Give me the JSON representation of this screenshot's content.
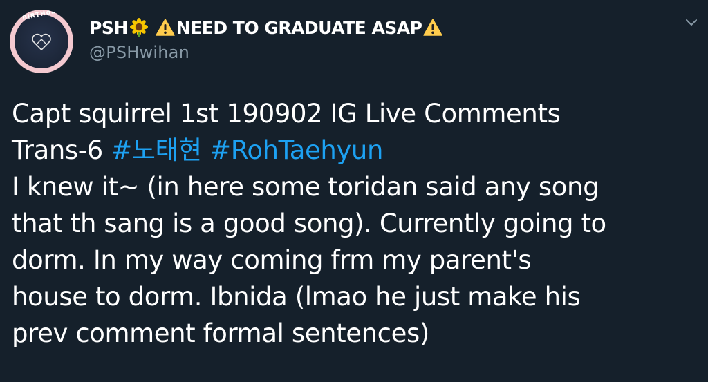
{
  "author": {
    "display_name_parts": [
      "PSH",
      "NEED TO GRADUATE ASAP"
    ],
    "display_name_emojis": [
      "sunflower-emoji",
      "warning-emoji",
      "warning-emoji"
    ],
    "handle": "@PSHwihan",
    "avatar_text": "BiRTHday"
  },
  "tweet": {
    "line1": "Capt squirrel 1st 190902 IG Live Comments",
    "line2_prefix": "Trans-6 ",
    "hashtags": [
      "#노태현",
      "#RohTaehyun"
    ],
    "lines": [
      "I knew it~ (in here some toridan said any song",
      "that th sang is a good song). Currently going to",
      "dorm. In my way coming frm my parent's",
      "house to dorm. Ibnida (lmao he just make his",
      "prev comment formal sentences)"
    ]
  },
  "colors": {
    "background": "#15202b",
    "text": "#ffffff",
    "secondary": "#8899a6",
    "link": "#1da1f2",
    "sunflower_petal": "#f7c500",
    "warning": "#ffcc4d"
  },
  "icons": {
    "menu": "chevron-down-icon"
  }
}
